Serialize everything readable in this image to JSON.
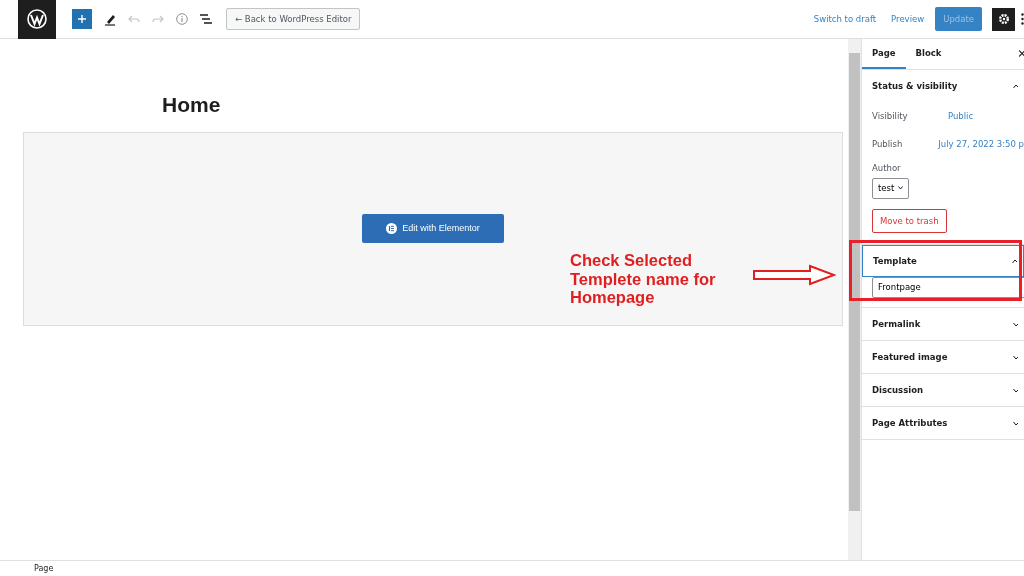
{
  "toolbar": {
    "back_button": "← Back to WordPress Editor",
    "undo_disabled": true,
    "redo_disabled": true,
    "switch_to_draft": "Switch to draft",
    "preview": "Preview",
    "update": "Update",
    "update_disabled": true,
    "settings_active": true
  },
  "editor": {
    "title": "Home",
    "elementor_button": "Edit with Elementor"
  },
  "sidebar": {
    "tabs": [
      {
        "label": "Page",
        "selected": true
      },
      {
        "label": "Block",
        "selected": false
      }
    ],
    "panels": [
      {
        "kind": "status",
        "title": "Status & visibility",
        "expanded": true,
        "focused": false,
        "rows": [
          {
            "label": "Visibility",
            "value": "Public"
          },
          {
            "label": "Publish",
            "value": "July 27, 2022 3:50 p"
          }
        ],
        "author_label": "Author",
        "author": "test",
        "trash_button": "Move to trash"
      },
      {
        "kind": "template",
        "title": "Template",
        "expanded": true,
        "focused": true,
        "value": "Frontpage"
      },
      {
        "title": "Permalink",
        "expanded": false,
        "focused": false
      },
      {
        "title": "Featured image",
        "expanded": false,
        "focused": false
      },
      {
        "title": "Discussion",
        "expanded": false,
        "focused": false
      },
      {
        "title": "Page Attributes",
        "expanded": false,
        "focused": false
      }
    ]
  },
  "status_bar": "Page",
  "annotation": {
    "text": "Check Selected Templete name for Homepage"
  }
}
